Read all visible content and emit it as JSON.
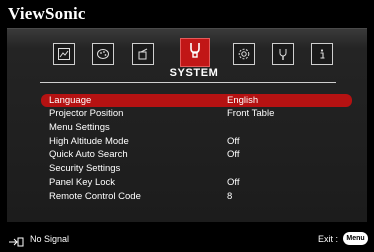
{
  "brand": "ViewSonic",
  "active_tab": "SYSTEM",
  "tabs": [
    {
      "id": "display",
      "icon": "image-icon"
    },
    {
      "id": "color",
      "icon": "palette-icon"
    },
    {
      "id": "audio",
      "icon": "audio-icon"
    },
    {
      "id": "system",
      "icon": "system-icon"
    },
    {
      "id": "advanced",
      "icon": "gear-icon"
    },
    {
      "id": "tools",
      "icon": "wrench-icon"
    },
    {
      "id": "information",
      "icon": "info-icon"
    }
  ],
  "menu": {
    "items": [
      {
        "label": "Language",
        "value": "English",
        "selected": true
      },
      {
        "label": "Projector Position",
        "value": "Front Table"
      },
      {
        "label": "Menu Settings",
        "value": ""
      },
      {
        "label": "High Altitude Mode",
        "value": "Off"
      },
      {
        "label": "Quick Auto Search",
        "value": "Off"
      },
      {
        "label": "Security Settings",
        "value": ""
      },
      {
        "label": "Panel Key Lock",
        "value": "Off"
      },
      {
        "label": "Remote Control Code",
        "value": "8"
      }
    ]
  },
  "footer": {
    "input_status": "No Signal",
    "exit_label": "Exit :",
    "menu_key": "Menu"
  },
  "colors": {
    "highlight": "#b51212",
    "panel": "#1c1c1c"
  }
}
